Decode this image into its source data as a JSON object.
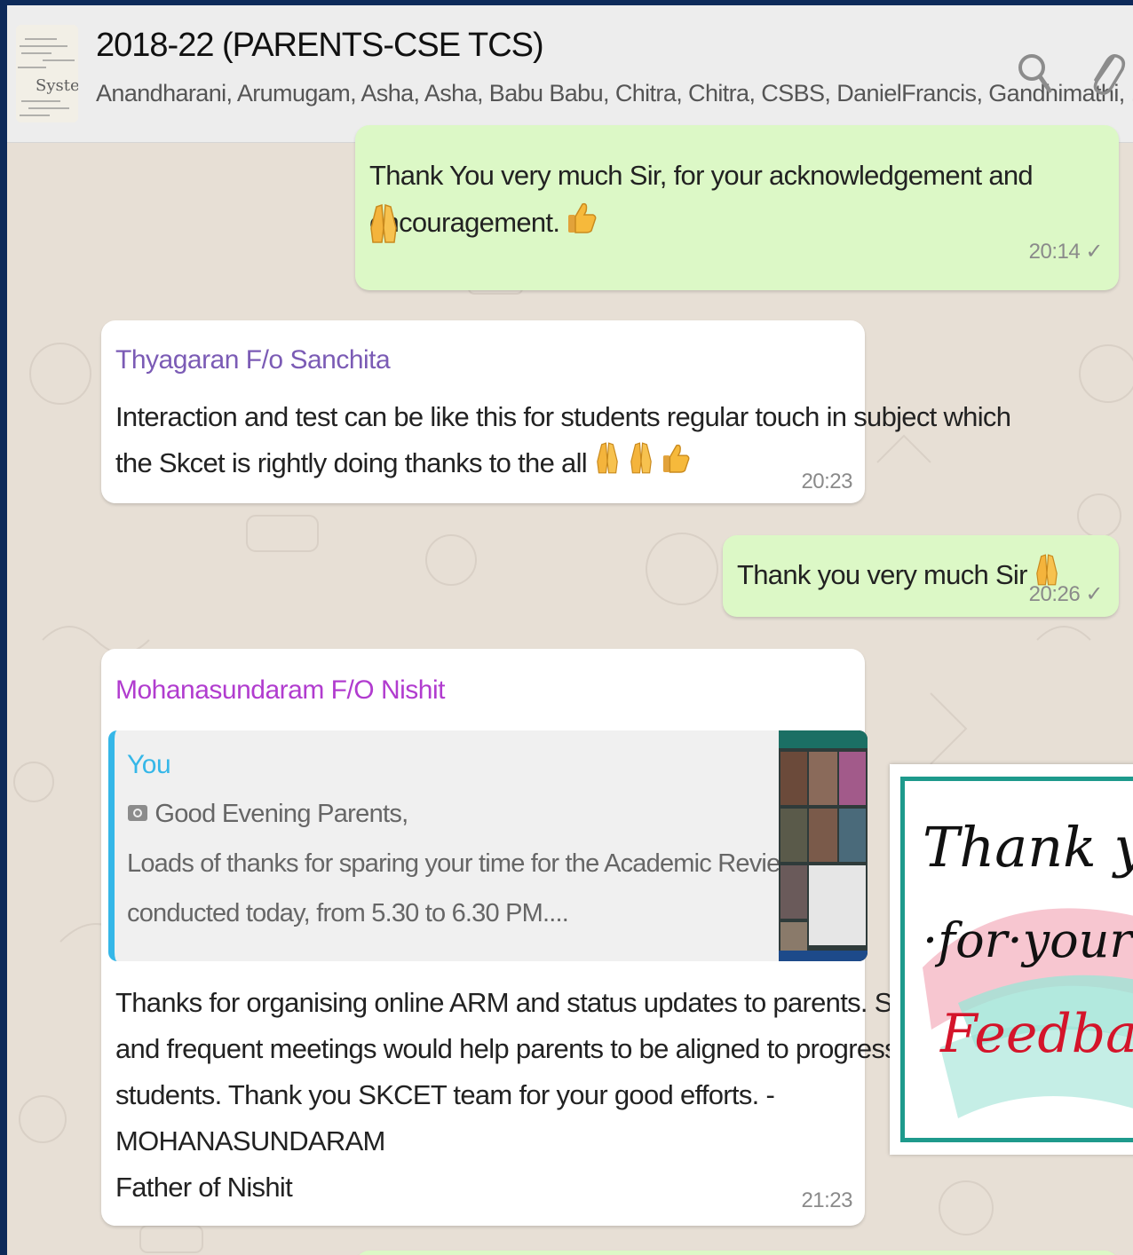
{
  "header": {
    "title": "2018-22 (PARENTS-CSE TCS)",
    "members": "Anandharani, Arumugam, Asha, Asha, Babu Babu, Chitra, Chitra, CSBS, DanielFrancis, Gandhimathi, ...",
    "avatar_text": "Systen"
  },
  "messages": [
    {
      "id": "m1",
      "direction": "outgoing",
      "text": "Thank You very much Sir, for your acknowledgement and encouragement.",
      "time": "20:14",
      "status": "✓"
    },
    {
      "id": "m2",
      "direction": "incoming",
      "sender": "Thyagaran F/o Sanchita",
      "sender_color": "#7b5bb5",
      "line1": "Interaction and test can be like this for students regular touch in subject which",
      "line2": "the Skcet is rightly doing thanks to the all",
      "time": "20:23"
    },
    {
      "id": "m3",
      "direction": "outgoing",
      "text": "Thank you very much Sir",
      "time": "20:26",
      "status": "✓"
    },
    {
      "id": "m4",
      "direction": "incoming",
      "sender": "Mohanasundaram F/O Nishit",
      "sender_color": "#b13ccf",
      "quote": {
        "author": "You",
        "line1": "Good Evening Parents,",
        "line2": "Loads of thanks for sparing your time for the Academic Review Meeting",
        "line3": "conducted today, from 5.30 to 6.30 PM...."
      },
      "lines": [
        "Thanks for organising online ARM and status updates to parents. Such regular",
        "and frequent meetings would help parents to be aligned to progress of",
        "students. Thank you SKCET team for your good efforts. -",
        "MOHANASUNDARAM",
        "Father of Nishit"
      ],
      "time": "21:23"
    }
  ],
  "card": {
    "line1": "Thank yo",
    "line2": "·for·your",
    "line3": "Feedbac"
  },
  "icons": {
    "search": "search-icon",
    "attach": "paperclip-icon",
    "pray": "folded-hands-icon",
    "thumbs": "thumbs-up-icon",
    "camera": "camera-icon"
  }
}
